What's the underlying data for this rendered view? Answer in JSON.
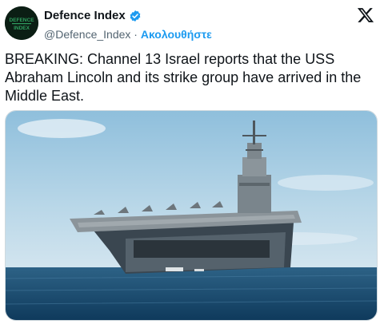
{
  "author": {
    "display_name": "Defence Index",
    "handle": "@Defence_Index",
    "separator": "·",
    "follow_label": "Ακολουθήστε",
    "avatar_text_line1": "DEFENCE",
    "avatar_text_line2": "INDEX",
    "verified": true
  },
  "tweet": {
    "text": "BREAKING: Channel 13 Israel reports that the USS Abraham Lincoln and its strike group have arrived in the Middle East."
  },
  "media": {
    "description_icon": "photo-aircraft-carrier"
  },
  "colors": {
    "accent": "#1d9bf0",
    "text": "#0f1419",
    "secondary_text": "#536471",
    "avatar_bg": "#0b1e14",
    "avatar_accent": "#2f9e5f"
  },
  "icons": {
    "verified": "verified-badge-icon",
    "platform": "x-logo-icon"
  }
}
